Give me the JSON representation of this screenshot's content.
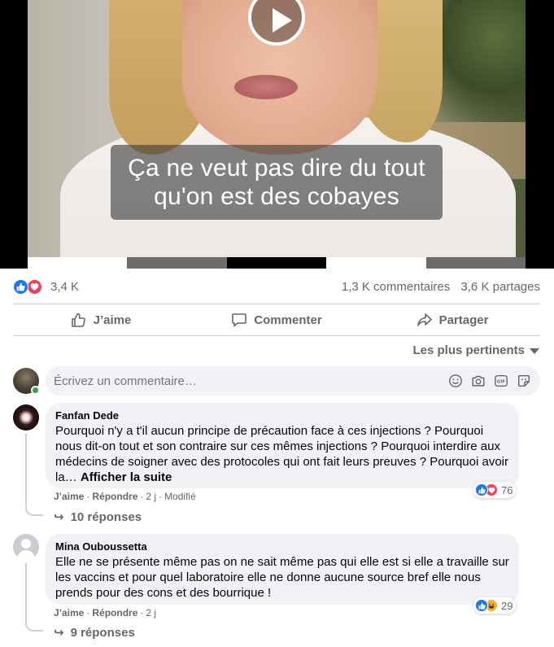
{
  "video": {
    "subtitle_lines": [
      "Ça ne veut pas dire du tout",
      "qu'on est des cobayes"
    ],
    "play_icon": "play-icon",
    "progress_segments": [
      "#ffffff",
      "#6b6b6b",
      "#000000",
      "#ffffff",
      "#6b6b6b"
    ]
  },
  "stats": {
    "reaction_icons": [
      "like-icon",
      "love-icon"
    ],
    "reactions_count": "3,4 K",
    "comments_count": "1,3 K commentaires",
    "shares_count": "3,6 K partages"
  },
  "actions": {
    "like": "J’aime",
    "comment": "Commenter",
    "share": "Partager"
  },
  "sort": {
    "label": "Les plus pertinents"
  },
  "compose": {
    "placeholder": "Écrivez un commentaire…",
    "icons": [
      "emoji-icon",
      "camera-icon",
      "gif-icon",
      "sticker-icon"
    ]
  },
  "comments": [
    {
      "author": "Fanfan Dede",
      "text": "Pourquoi n'y a t'il aucun principe de précaution face à ces injections ? Pourquoi nous dit-on tout et son contraire sur ces mêmes injections ? Pourquoi interdire aux médecins de soigner avec des protocoles qui ont fait leurs preuves ? Pourquoi avoir la…",
      "see_more": "Afficher la suite",
      "like_label": "J’aime",
      "reply_label": "Répondre",
      "time": "2 j",
      "edited": "Modifié",
      "reaction_count": "76",
      "reaction_icons": [
        "like-icon",
        "love-icon"
      ],
      "replies_label": "10 réponses"
    },
    {
      "author": "Mina Ouboussetta",
      "text": "Elle ne se présente même pas on ne sait même pas qui elle est si elle a travaille sur les vaccins et pour quel laboratoire elle ne donne aucune source bref elle nous prends pour des cons et des bourrique !",
      "like_label": "J’aime",
      "reply_label": "Répondre",
      "time": "2 j",
      "reaction_count": "29",
      "reaction_icons": [
        "like-icon",
        "haha-icon"
      ],
      "replies_label": "9 réponses"
    }
  ],
  "colors": {
    "facebook_blue": "#1877f2",
    "love_red": "#f33e58",
    "haha_yellow": "#f7b125",
    "secondary_text": "#65676b",
    "bubble_bg": "#f0f2f5"
  }
}
